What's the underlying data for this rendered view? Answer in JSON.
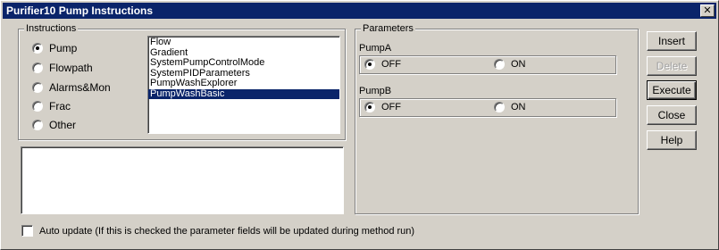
{
  "window": {
    "title": "Purifier10 Pump Instructions",
    "close_label": "✕"
  },
  "instructions": {
    "group_title": "Instructions",
    "categories": [
      {
        "label": "Pump",
        "checked": true
      },
      {
        "label": "Flowpath",
        "checked": false
      },
      {
        "label": "Alarms&Mon",
        "checked": false
      },
      {
        "label": "Frac",
        "checked": false
      },
      {
        "label": "Other",
        "checked": false
      }
    ],
    "list_items": [
      "Flow",
      "Gradient",
      "SystemPumpControlMode",
      "SystemPIDParameters",
      "PumpWashExplorer",
      "PumpWashBasic"
    ],
    "selected_item": "PumpWashBasic"
  },
  "parameters": {
    "group_title": "Parameters",
    "pumps": [
      {
        "label": "PumpA",
        "off_label": "OFF",
        "on_label": "ON",
        "selected": "OFF"
      },
      {
        "label": "PumpB",
        "off_label": "OFF",
        "on_label": "ON",
        "selected": "OFF"
      }
    ]
  },
  "buttons": {
    "insert": "Insert",
    "delete": "Delete",
    "execute": "Execute",
    "close": "Close",
    "help": "Help"
  },
  "auto_update": {
    "label": "Auto update (If this is checked the parameter fields will be updated during method run)",
    "checked": false
  },
  "colors": {
    "title_bar": "#0a246a",
    "selection": "#0a246a",
    "face": "#d4d0c8"
  }
}
